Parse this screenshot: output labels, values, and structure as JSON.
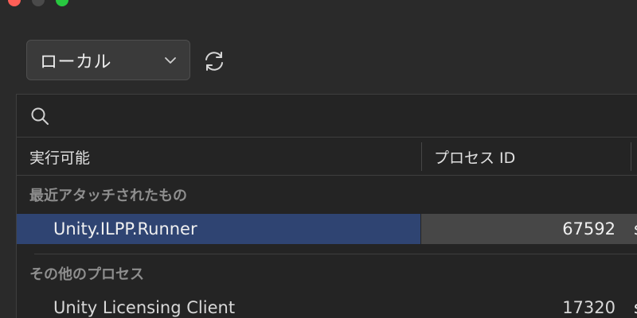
{
  "toolbar": {
    "target_label": "ローカル",
    "refresh_icon": "refresh-icon"
  },
  "search": {
    "value": "",
    "placeholder": ""
  },
  "table": {
    "columns": [
      "実行可能",
      "プロセス ID"
    ],
    "sections": [
      {
        "title": "最近アタッチされたもの",
        "rows": [
          {
            "name": "Unity.ILPP.Runner",
            "pid": "67592",
            "extra": "s",
            "selected": true
          }
        ]
      },
      {
        "title": "その他のプロセス",
        "rows": [
          {
            "name": "Unity Licensing Client",
            "pid": "17320",
            "extra": "s",
            "selected": false
          }
        ]
      }
    ]
  },
  "colors": {
    "selection": "#2f4472",
    "background": "#2a2a2a"
  }
}
